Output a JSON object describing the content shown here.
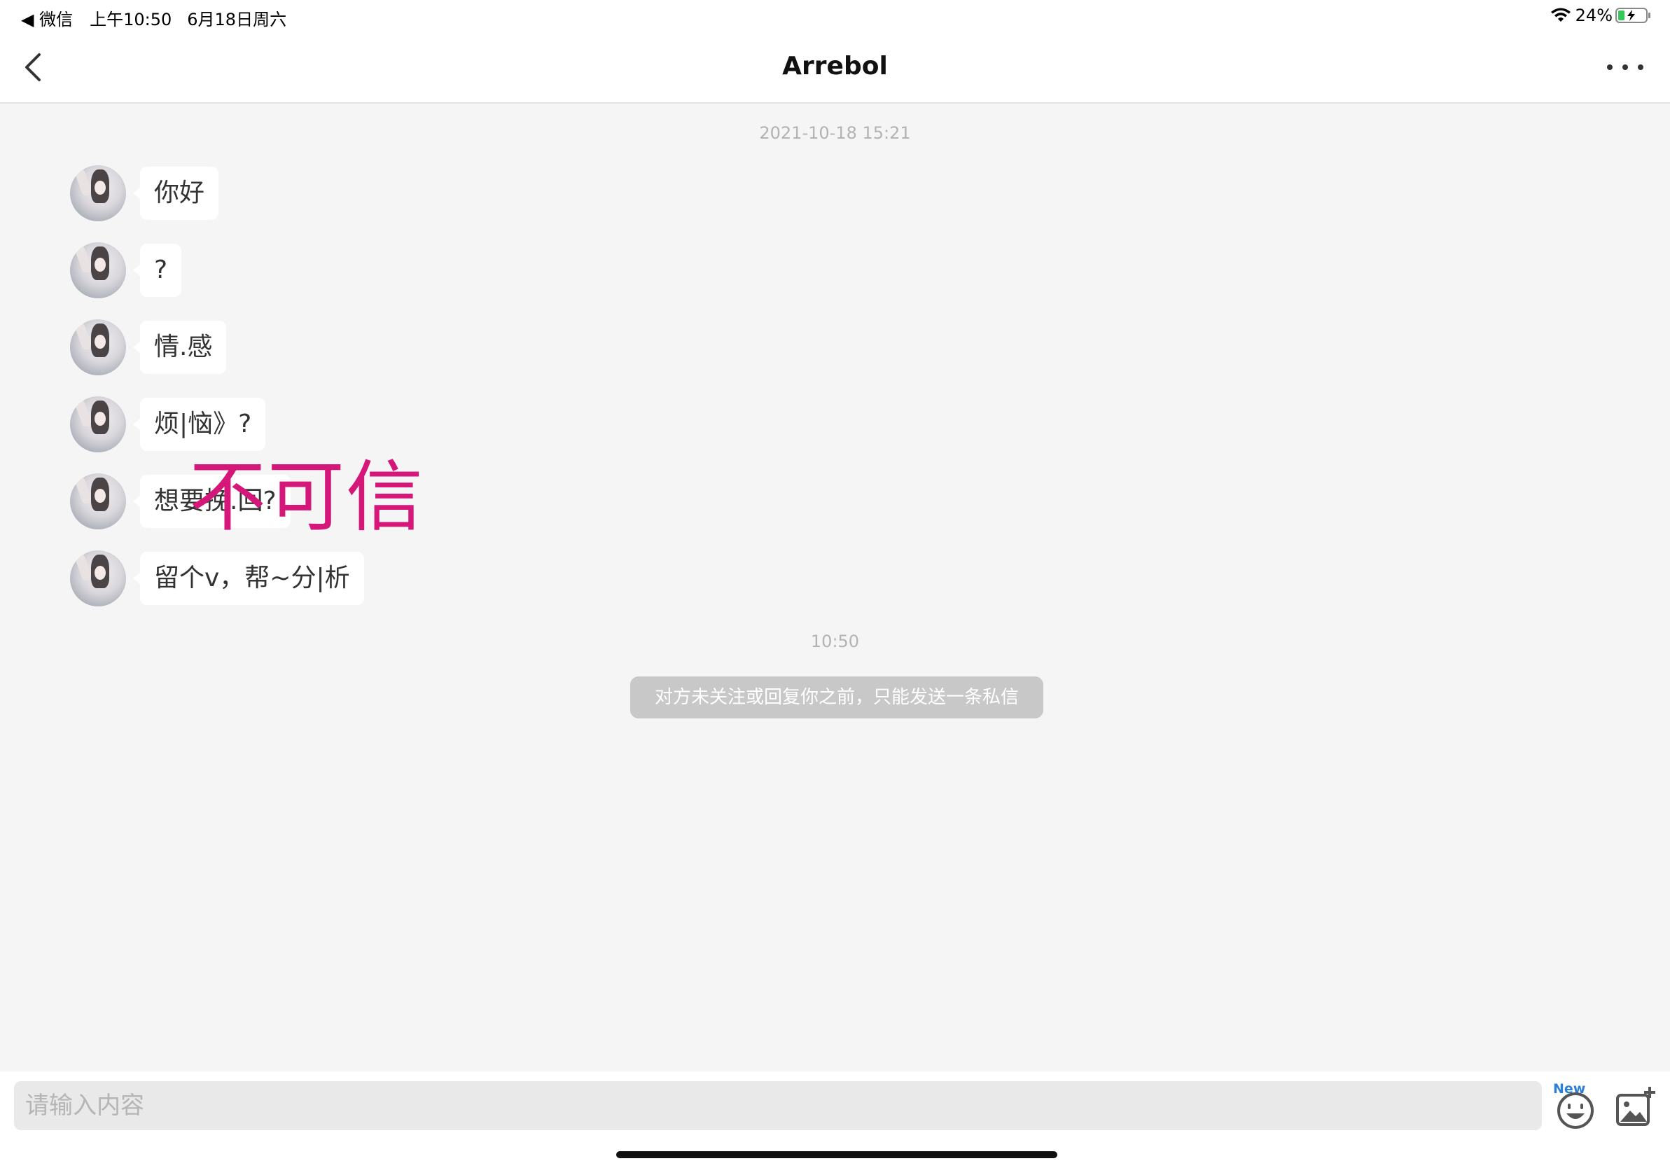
{
  "status_bar": {
    "back_app": "◀ 微信",
    "time": "上午10:50",
    "date": "6月18日周六",
    "battery_percent": "24%",
    "battery_level": 0.24
  },
  "nav": {
    "title": "Arrebol",
    "back_icon": "chevron-left-icon",
    "more_icon": "more-dots-icon"
  },
  "chat": {
    "timestamp_1": "2021-10-18 15:21",
    "messages": [
      {
        "text": "你好"
      },
      {
        "text": "?"
      },
      {
        "text": "情.感"
      },
      {
        "text": "烦|恼》?"
      },
      {
        "text": "想要挽.回?"
      },
      {
        "text": "留个v，帮~分|析"
      }
    ],
    "watermark": "不可信",
    "timestamp_2": "10:50",
    "notice": "对方未关注或回复你之前，只能发送一条私信"
  },
  "input_bar": {
    "placeholder": "请输入内容",
    "new_badge": "New",
    "emoji_icon": "emoji-icon",
    "image_icon": "add-image-icon"
  },
  "colors": {
    "background": "#f5f5f5",
    "watermark": "#d6177a",
    "new_badge": "#2b7fd9"
  }
}
